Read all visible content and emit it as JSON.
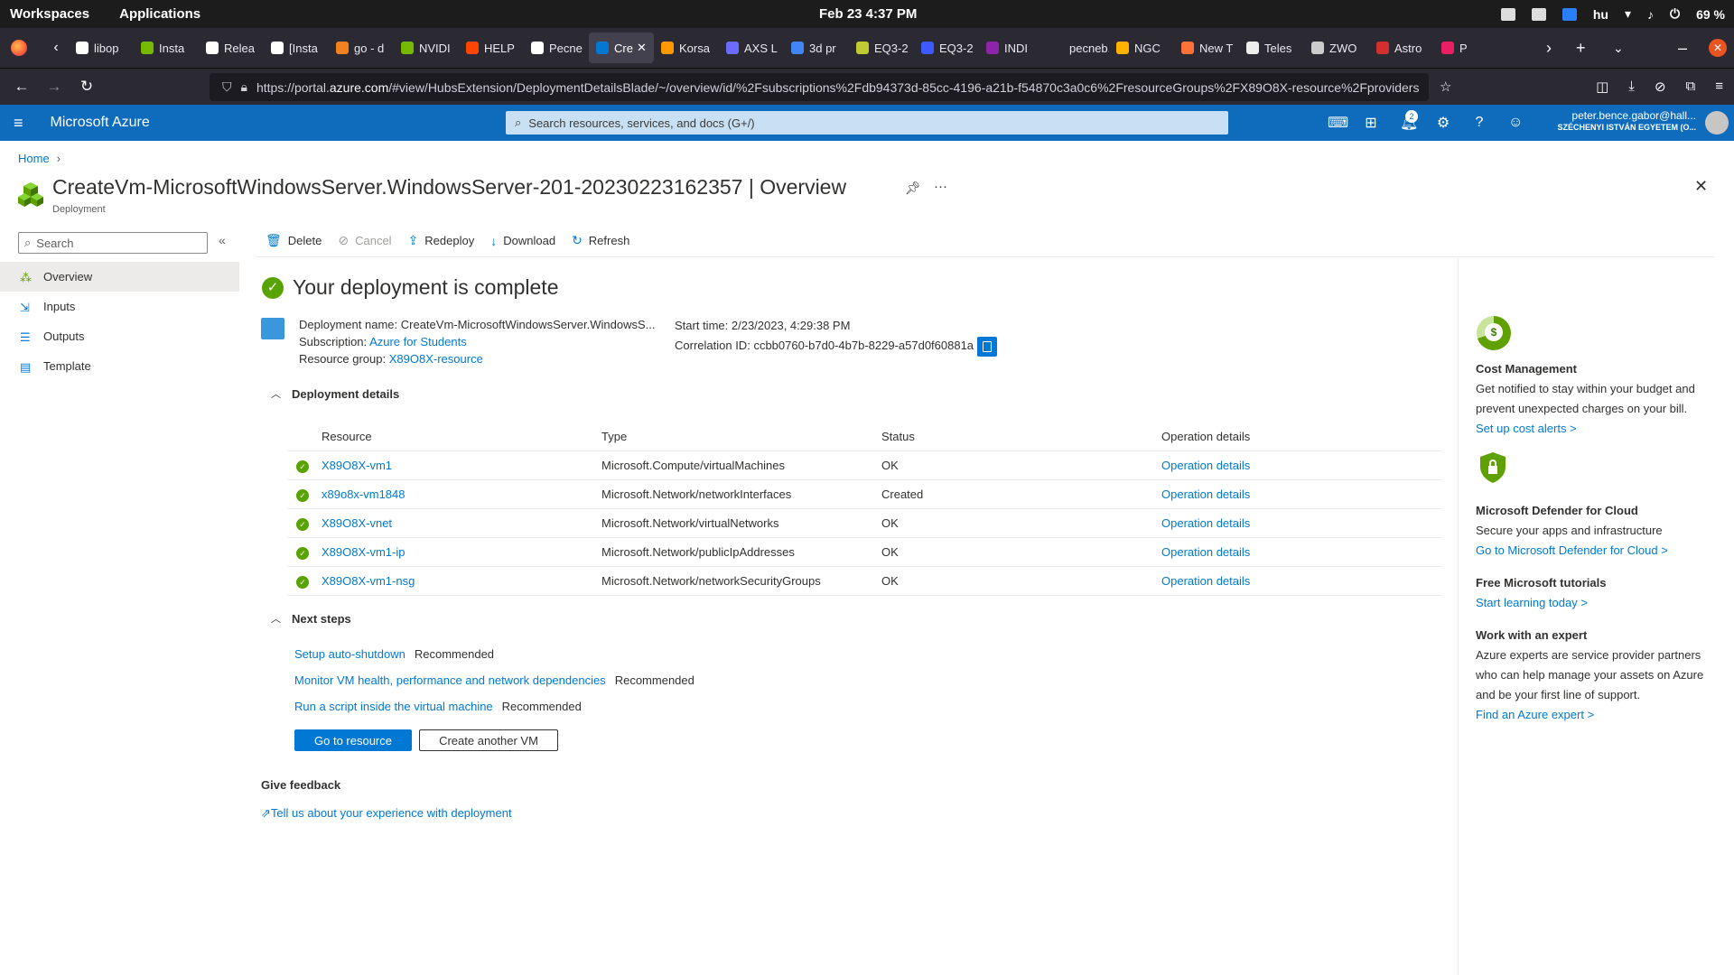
{
  "os": {
    "workspaces": "Workspaces",
    "applications": "Applications",
    "clock": "Feb 23  4:37 PM",
    "lang": "hu",
    "battery": "69 %"
  },
  "browser": {
    "tabs": [
      {
        "label": "libop",
        "color": "#ffffff"
      },
      {
        "label": "Insta",
        "color": "#76b900"
      },
      {
        "label": "Relea",
        "color": "#ffffff"
      },
      {
        "label": "[Insta",
        "color": "#ffffff"
      },
      {
        "label": "go - d",
        "color": "#f48120"
      },
      {
        "label": "NVIDI",
        "color": "#76b900"
      },
      {
        "label": "HELP",
        "color": "#ff4500"
      },
      {
        "label": "Pecne",
        "color": "#ffffff"
      },
      {
        "label": "Cre",
        "color": "#0078d4",
        "active": true
      },
      {
        "label": "Korsa",
        "color": "#ff9900"
      },
      {
        "label": "AXS L",
        "color": "#6b6bff"
      },
      {
        "label": "3d pr",
        "color": "#4285f4"
      },
      {
        "label": "EQ3-2",
        "color": "#c0ca33"
      },
      {
        "label": "EQ3-2",
        "color": "#3d5afe"
      },
      {
        "label": "INDI",
        "color": "#8e24aa"
      },
      {
        "label": "pecneb.g",
        "color": "#2b2a33"
      },
      {
        "label": "NGC",
        "color": "#ffb300"
      },
      {
        "label": "New T",
        "color": "#ff7139"
      },
      {
        "label": "Teles",
        "color": "#eeeeee"
      },
      {
        "label": "ZWO",
        "color": "#cccccc"
      },
      {
        "label": "Astro",
        "color": "#d32f2f"
      },
      {
        "label": "P",
        "color": "#e91e63"
      }
    ],
    "url_prefix": "https://portal.",
    "url_host": "azure.com",
    "url_rest": "/#view/HubsExtension/DeploymentDetailsBlade/~/overview/id/%2Fsubscriptions%2Fdb94373d-85cc-4196-a21b-f54870c3a0c6%2FresourceGroups%2FX89O8X-resource%2Fproviders"
  },
  "azure": {
    "brand": "Microsoft Azure",
    "search_placeholder": "Search resources, services, and docs (G+/)",
    "notif_count": "2",
    "user_email": "peter.bence.gabor@hall...",
    "user_org": "SZÉCHENYI ISTVÁN EGYETEM (O..."
  },
  "page": {
    "breadcrumb_home": "Home",
    "title": "CreateVm-MicrosoftWindowsServer.WindowsServer-201-20230223162357 | Overview",
    "subtitle": "Deployment",
    "close": "✕"
  },
  "leftnav": {
    "search_placeholder": "Search",
    "items": [
      {
        "label": "Overview",
        "selected": true
      },
      {
        "label": "Inputs"
      },
      {
        "label": "Outputs"
      },
      {
        "label": "Template"
      }
    ]
  },
  "toolbar": {
    "delete": "Delete",
    "cancel": "Cancel",
    "redeploy": "Redeploy",
    "download": "Download",
    "refresh": "Refresh"
  },
  "deployment": {
    "headline": "Your deployment is complete",
    "name_label": "Deployment name:",
    "name_value": "CreateVm-MicrosoftWindowsServer.WindowsS...",
    "subscription_label": "Subscription:",
    "subscription_value": "Azure for Students",
    "rg_label": "Resource group:",
    "rg_value": "X89O8X-resource",
    "start_label": "Start time:",
    "start_value": "2/23/2023, 4:29:38 PM",
    "corr_label": "Correlation ID:",
    "corr_value": "ccbb0760-b7d0-4b7b-8229-a57d0f60881a"
  },
  "details": {
    "section": "Deployment details",
    "headers": [
      "Resource",
      "Type",
      "Status",
      "Operation details"
    ],
    "rows": [
      {
        "resource": "X89O8X-vm1",
        "type": "Microsoft.Compute/virtualMachines",
        "status": "OK",
        "op": "Operation details"
      },
      {
        "resource": "x89o8x-vm1848",
        "type": "Microsoft.Network/networkInterfaces",
        "status": "Created",
        "op": "Operation details"
      },
      {
        "resource": "X89O8X-vnet",
        "type": "Microsoft.Network/virtualNetworks",
        "status": "OK",
        "op": "Operation details"
      },
      {
        "resource": "X89O8X-vm1-ip",
        "type": "Microsoft.Network/publicIpAddresses",
        "status": "OK",
        "op": "Operation details"
      },
      {
        "resource": "X89O8X-vm1-nsg",
        "type": "Microsoft.Network/networkSecurityGroups",
        "status": "OK",
        "op": "Operation details"
      }
    ]
  },
  "next_steps": {
    "section": "Next steps",
    "items": [
      {
        "link": "Setup auto-shutdown",
        "tag": "Recommended"
      },
      {
        "link": "Monitor VM health, performance and network dependencies",
        "tag": "Recommended"
      },
      {
        "link": "Run a script inside the virtual machine",
        "tag": "Recommended"
      }
    ],
    "go_button": "Go to resource",
    "create_button": "Create another VM"
  },
  "feedback": {
    "heading": "Give feedback",
    "link": "Tell us about your experience with deployment"
  },
  "rightpanel": {
    "cost_title": "Cost Management",
    "cost_desc": "Get notified to stay within your budget and prevent unexpected charges on your bill.",
    "cost_link": "Set up cost alerts >",
    "defender_title": "Microsoft Defender for Cloud",
    "defender_desc": "Secure your apps and infrastructure",
    "defender_link": "Go to Microsoft Defender for Cloud >",
    "tutorials_title": "Free Microsoft tutorials",
    "tutorials_link": "Start learning today >",
    "expert_title": "Work with an expert",
    "expert_desc": "Azure experts are service provider partners who can help manage your assets on Azure and be your first line of support.",
    "expert_link": "Find an Azure expert >"
  }
}
